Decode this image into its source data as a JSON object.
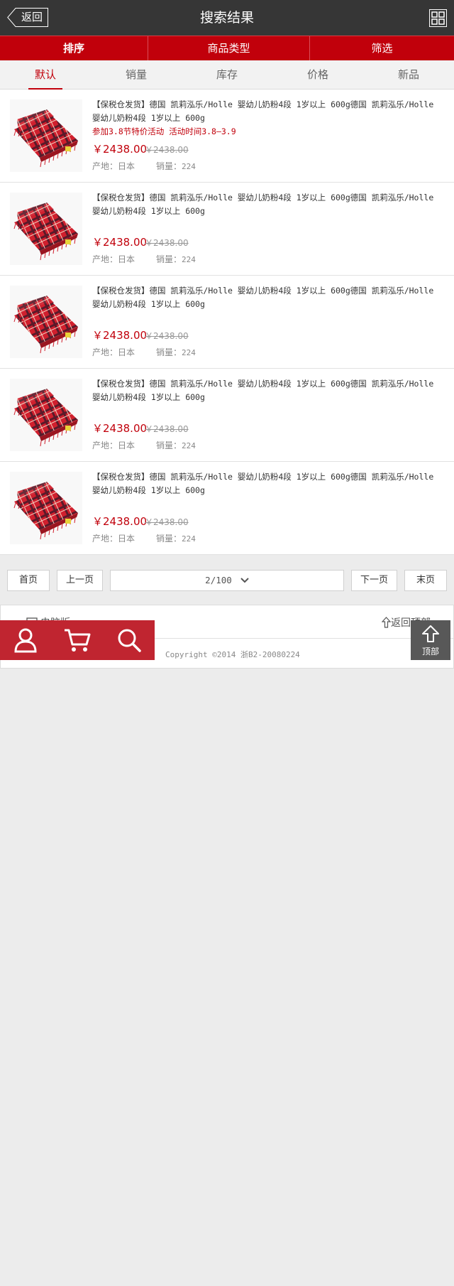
{
  "header": {
    "back_label": "返回",
    "title": "搜索结果",
    "grid_icon": "grid-icon"
  },
  "redbar": {
    "tabs": [
      "排序",
      "商品类型",
      "筛选"
    ]
  },
  "sortbar": {
    "tabs": [
      "默认",
      "销量",
      "库存",
      "价格",
      "新品"
    ],
    "active": "默认"
  },
  "products": [
    {
      "title": "【保税仓发货】德国 凯莉泓乐/Holle 婴幼儿奶粉4段 1岁以上 600g德国 凯莉泓乐/Holle 婴幼儿奶粉4段 1岁以上 600g",
      "promo": "参加3.8节特价活动 活动时间3.8—3.9",
      "price": "￥2438.00",
      "old_price": "￥2438.00",
      "origin_label": "产地：",
      "origin": "日本",
      "sales_label": "销量：",
      "sales": "224"
    },
    {
      "title": "【保税仓发货】德国 凯莉泓乐/Holle 婴幼儿奶粉4段 1岁以上 600g德国 凯莉泓乐/Holle 婴幼儿奶粉4段 1岁以上 600g",
      "promo": "",
      "price": "￥2438.00",
      "old_price": "￥2438.00",
      "origin_label": "产地：",
      "origin": "日本",
      "sales_label": "销量：",
      "sales": "224"
    },
    {
      "title": "【保税仓发货】德国 凯莉泓乐/Holle 婴幼儿奶粉4段 1岁以上 600g德国 凯莉泓乐/Holle 婴幼儿奶粉4段 1岁以上 600g",
      "promo": "",
      "price": "￥2438.00",
      "old_price": "￥2438.00",
      "origin_label": "产地：",
      "origin": "日本",
      "sales_label": "销量：",
      "sales": "224"
    },
    {
      "title": "【保税仓发货】德国 凯莉泓乐/Holle 婴幼儿奶粉4段 1岁以上 600g德国 凯莉泓乐/Holle 婴幼儿奶粉4段 1岁以上 600g",
      "promo": "",
      "price": "￥2438.00",
      "old_price": "￥2438.00",
      "origin_label": "产地：",
      "origin": "日本",
      "sales_label": "销量：",
      "sales": "224"
    },
    {
      "title": "【保税仓发货】德国 凯莉泓乐/Holle 婴幼儿奶粉4段 1岁以上 600g德国 凯莉泓乐/Holle 婴幼儿奶粉4段 1岁以上 600g",
      "promo": "",
      "price": "￥2438.00",
      "old_price": "￥2438.00",
      "origin_label": "产地：",
      "origin": "日本",
      "sales_label": "销量：",
      "sales": "224"
    }
  ],
  "pager": {
    "first": "首页",
    "prev": "上一页",
    "current": "2/100",
    "next": "下一页",
    "last": "末页"
  },
  "footer": {
    "pc_label": "电脑版",
    "top_label": "返回顶部",
    "copyright": "Copyright ©2014 浙B2-20080224"
  },
  "floatbar": {
    "icons": [
      "user-icon",
      "cart-icon",
      "search-icon"
    ]
  },
  "backtop": {
    "label": "顶部"
  },
  "colors": {
    "header_bg": "#363636",
    "accent_red": "#c1000b",
    "float_red": "#c02530",
    "backtop_bg": "#585858"
  }
}
